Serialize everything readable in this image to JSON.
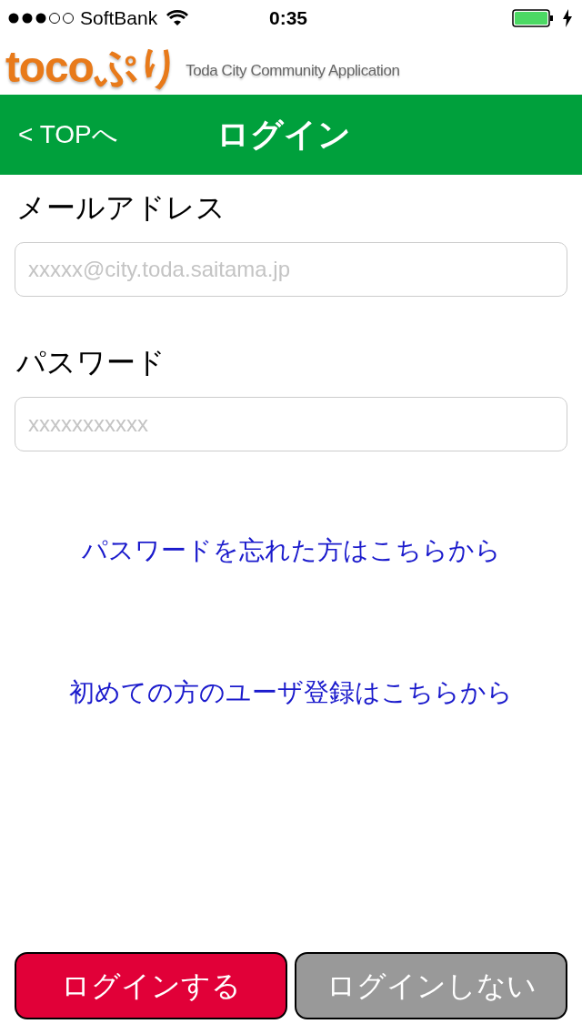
{
  "status_bar": {
    "carrier": "SoftBank",
    "time": "0:35"
  },
  "header": {
    "logo": "tocoぷり",
    "tagline": "Toda City Community Application"
  },
  "nav_bar": {
    "back": "< TOPへ",
    "title": "ログイン"
  },
  "fields": [
    {
      "label": "メールアドレス",
      "placeholder": "xxxxx@city.toda.saitama.jp"
    },
    {
      "label": "パスワード",
      "placeholder": "xxxxxxxxxxx"
    }
  ],
  "links": [
    "パスワードを忘れた方はこちらから",
    "初めての方のユーザ登録はこちらから"
  ],
  "buttons": [
    {
      "label": "ログインする",
      "kind": "primary"
    },
    {
      "label": "ログインしない",
      "kind": "secondary"
    }
  ]
}
